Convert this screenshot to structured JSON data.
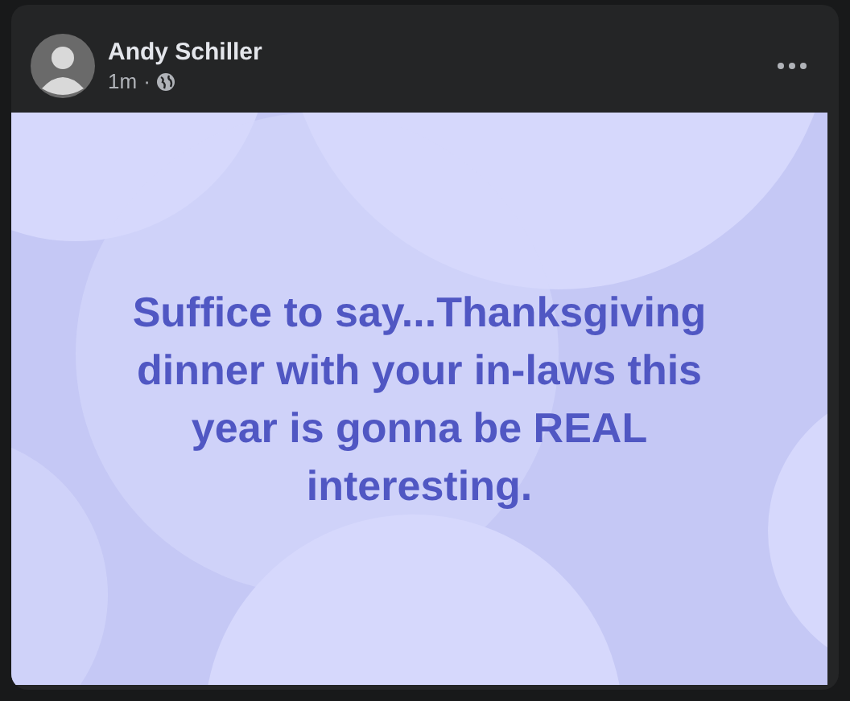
{
  "post": {
    "author": "Andy Schiller",
    "time": "1m",
    "separator": "·",
    "text": "Suffice to say...Thanksgiving dinner with your in-laws this year is gonna be REAL interesting."
  }
}
